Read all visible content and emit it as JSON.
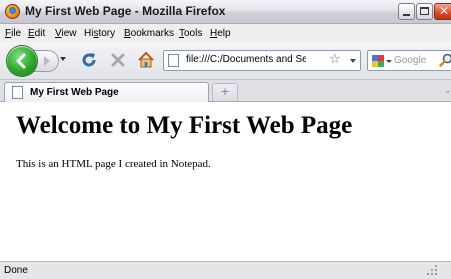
{
  "window": {
    "title": "My First Web Page - Mozilla Firefox",
    "app_icon": "firefox-icon",
    "controls": [
      "minimize-icon",
      "maximize-icon",
      "close-icon"
    ]
  },
  "menubar": {
    "items": [
      {
        "pre": "",
        "key": "F",
        "post": "ile"
      },
      {
        "pre": "",
        "key": "E",
        "post": "dit"
      },
      {
        "pre": "",
        "key": "V",
        "post": "iew"
      },
      {
        "pre": "Hi",
        "key": "s",
        "post": "tory"
      },
      {
        "pre": "",
        "key": "B",
        "post": "ookmarks"
      },
      {
        "pre": "",
        "key": "T",
        "post": "ools"
      },
      {
        "pre": "",
        "key": "H",
        "post": "elp"
      }
    ]
  },
  "navbar": {
    "address": "file:///C:/Documents and Settings/J",
    "search_placeholder": "Google",
    "icons": [
      "back-arrow-icon",
      "forward-arrow-icon",
      "reload-icon",
      "stop-icon",
      "home-icon",
      "bookmark-star-icon",
      "search-magnifier-icon"
    ]
  },
  "tabs": {
    "active_label": "My First Web Page",
    "new_tab_glyph": "+"
  },
  "page": {
    "heading": "Welcome to My First Web Page",
    "paragraph": "This is an HTML page I created in Notepad."
  },
  "status": {
    "text": "Done"
  },
  "colors": {
    "back_button": "#2aa52a",
    "close_button": "#d94a22"
  }
}
